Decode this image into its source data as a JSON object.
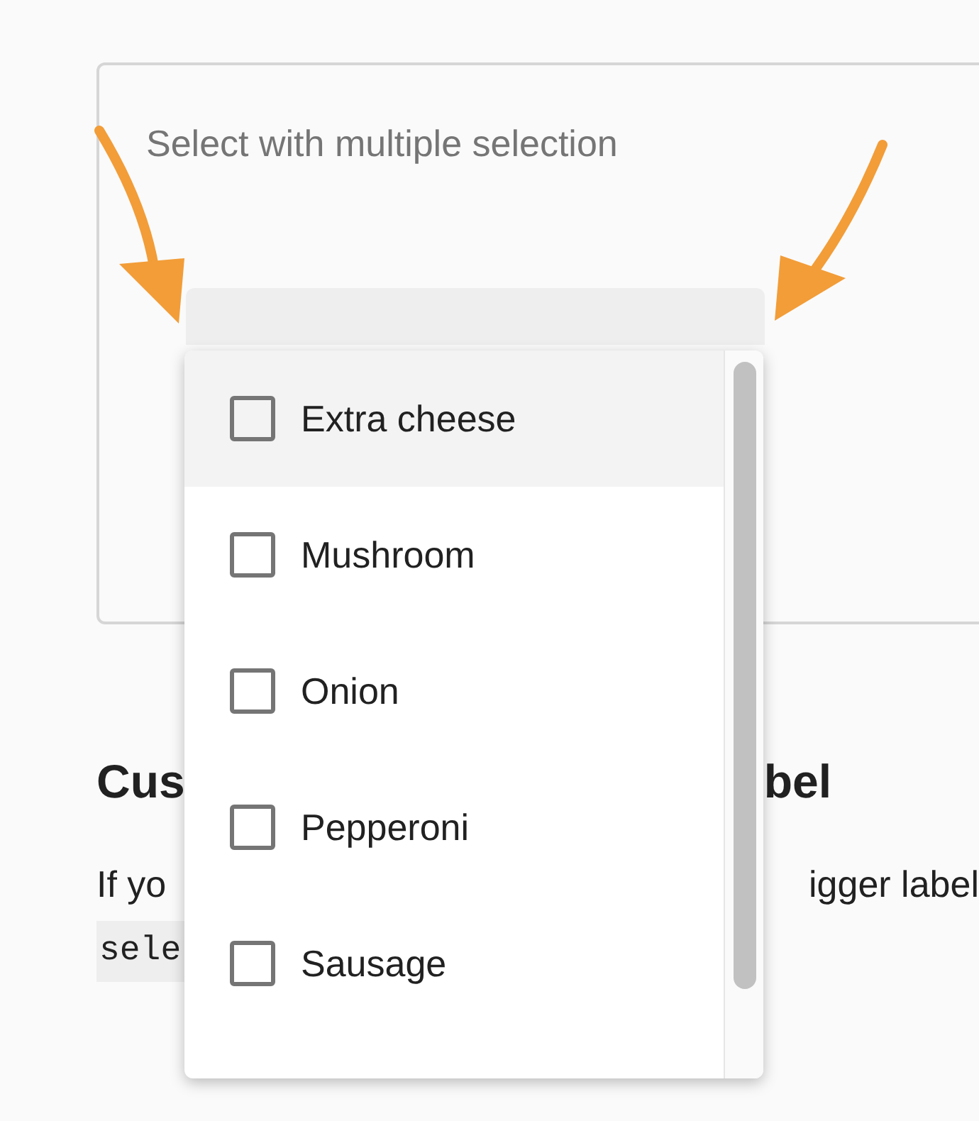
{
  "card": {
    "title": "Select with multiple selection"
  },
  "dropdown": {
    "options": [
      {
        "label": "Extra cheese",
        "checked": false,
        "focused": true
      },
      {
        "label": "Mushroom",
        "checked": false,
        "focused": false
      },
      {
        "label": "Onion",
        "checked": false,
        "focused": false
      },
      {
        "label": "Pepperoni",
        "checked": false,
        "focused": false
      },
      {
        "label": "Sausage",
        "checked": false,
        "focused": false
      }
    ]
  },
  "heading": {
    "left_part": "Cus",
    "right_part": "bel"
  },
  "paragraph": {
    "left_part": "If yo",
    "right_part": "igger label"
  },
  "code": "sele"
}
